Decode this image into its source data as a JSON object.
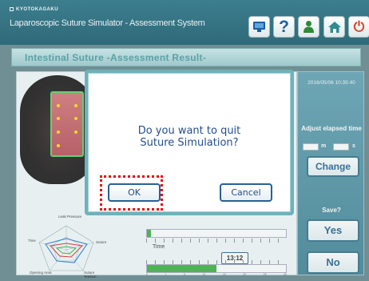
{
  "header": {
    "brand": "KYOTOKAGAKU",
    "app_title": "Laparoscopic Suture Simulator - Assessment System",
    "toolbar": {
      "monitor_icon": "monitor-icon",
      "help_label": "?",
      "person_icon": "person-icon",
      "home_icon": "home-icon",
      "power_label": "⏻"
    }
  },
  "subtitle": "Intestinal Suture -Assessment Result-",
  "radar": {
    "labels": [
      "Leak Pressure",
      "Suture",
      "Suture Tension",
      "Opening Area",
      "Time"
    ]
  },
  "timeline": {
    "time_label": "Time",
    "readout": "13:12",
    "upper_fill_fraction": 0.03,
    "lower_fill_fraction": 0.5,
    "tick_numbers": [
      "0",
      "1",
      "5",
      "10",
      "15",
      "20",
      "25",
      "30"
    ]
  },
  "side_panel": {
    "timestamp": "2016/05/06 10:35:40",
    "adjust_label": "Adjust elapsed time",
    "minutes_unit": "m",
    "seconds_unit": "s",
    "change_label": "Change",
    "save_label": "Save?",
    "yes_label": "Yes",
    "no_label": "No"
  },
  "dialog": {
    "message_line1": "Do you want to quit",
    "message_line2": "Suture Simulation?",
    "ok_label": "OK",
    "cancel_label": "Cancel"
  },
  "colors": {
    "titlebar": "#2e6a79",
    "dialog_border": "#6fb2bb",
    "dialog_text": "#244f8e",
    "highlight": "#e20e12",
    "gauge_fill": "#3bae3e"
  }
}
